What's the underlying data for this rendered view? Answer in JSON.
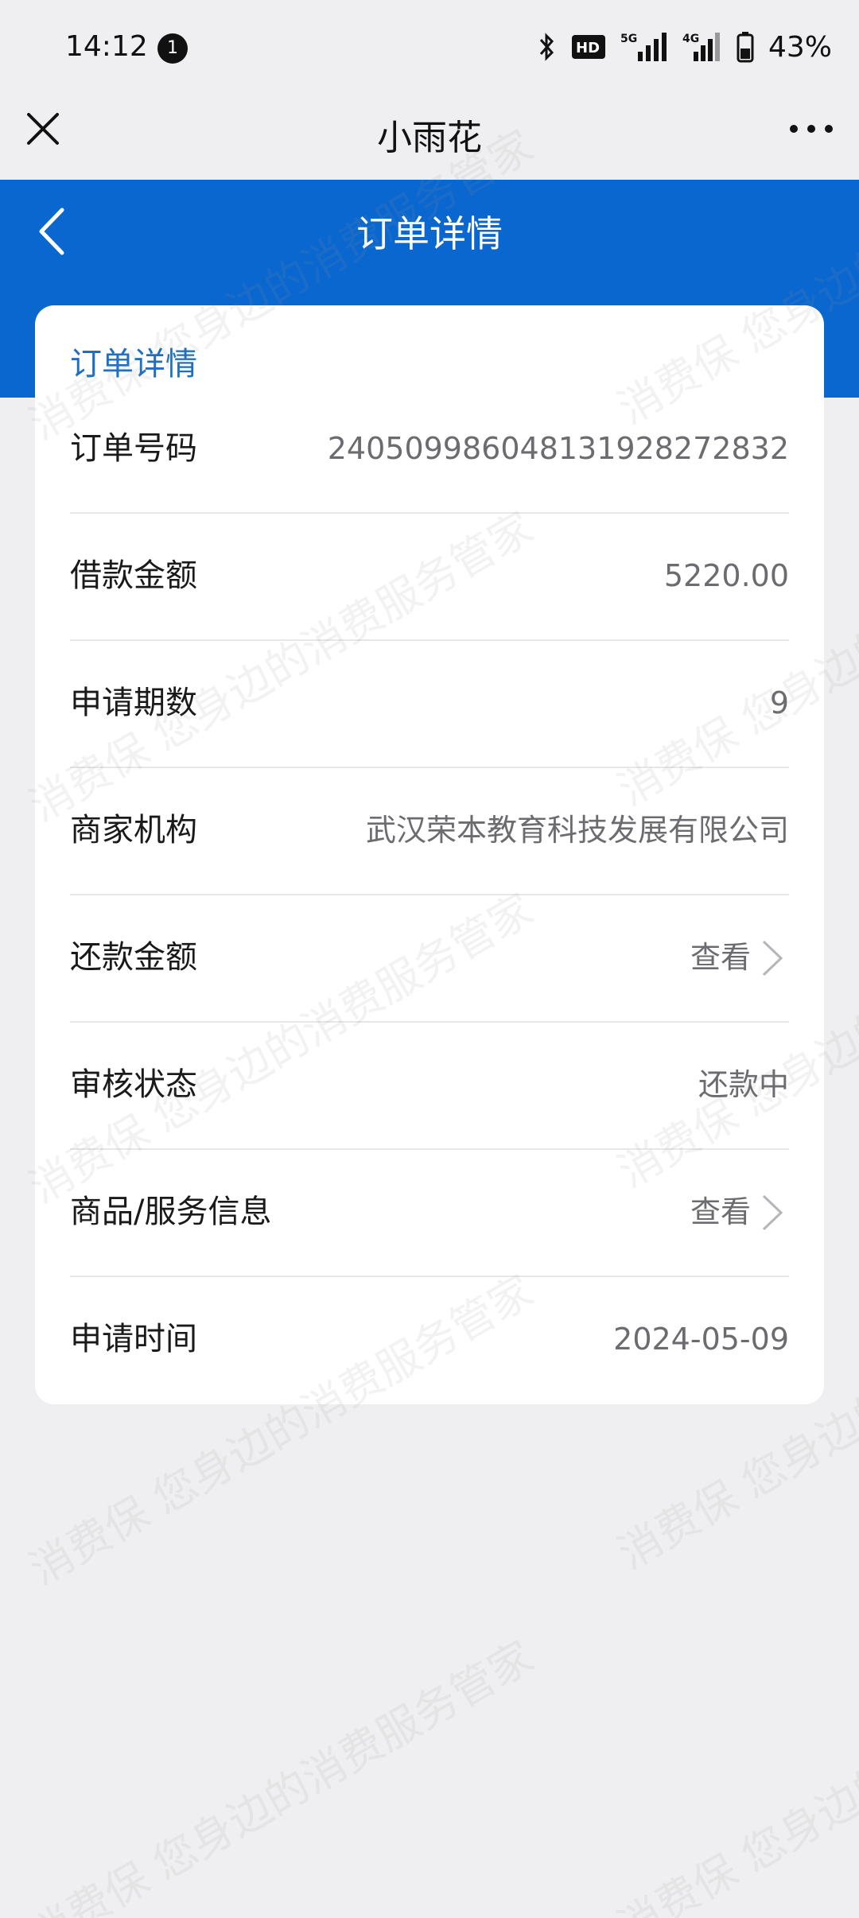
{
  "status_bar": {
    "time": "14:12",
    "notification_count": "1",
    "hd_label": "HD",
    "signal_5g": "5G",
    "signal_4g": "4G",
    "battery": "43%"
  },
  "mini_program": {
    "title": "小雨花"
  },
  "header": {
    "title": "订单详情"
  },
  "card": {
    "section_title": "订单详情",
    "rows": [
      {
        "label": "订单号码",
        "value": "240509986048131928272832"
      },
      {
        "label": "借款金额",
        "value": "5220.00"
      },
      {
        "label": "申请期数",
        "value": "9"
      },
      {
        "label": "商家机构",
        "value": "武汉荣本教育科技发展有限公司"
      },
      {
        "label": "还款金额",
        "value": "查看"
      },
      {
        "label": "审核状态",
        "value": "还款中"
      },
      {
        "label": "商品/服务信息",
        "value": "查看"
      },
      {
        "label": "申请时间",
        "value": "2024-05-09"
      }
    ]
  },
  "watermark": {
    "line1": "消费保 您身边的消费服务管家"
  },
  "colors": {
    "brand_blue": "#0a67cf",
    "section_title_blue": "#1d6fc2",
    "page_bg": "#efeff1"
  }
}
